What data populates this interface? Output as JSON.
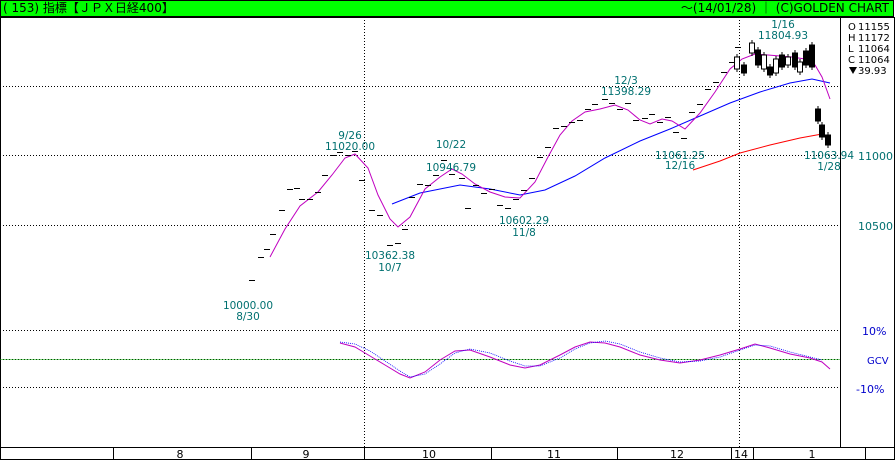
{
  "header": {
    "code": "( 153)",
    "name": "指標【ＪＰＸ日経400】",
    "date": "～(14/01/28)",
    "brand": "(C)GOLDEN CHART"
  },
  "ohlc": {
    "open_label": "O",
    "open": "11155",
    "high_label": "H",
    "high": "11172",
    "low_label": "L",
    "low": "11064",
    "close_label": "C",
    "close": "11064",
    "change": "39.93"
  },
  "colors": {
    "title_bg": "#00ff00",
    "label": "#007070",
    "ma_short": "#0000ff",
    "ma_long": "#ff0000",
    "stoch": "#c000c0"
  },
  "chart_data": {
    "type": "candlestick",
    "y_ticks": [
      10500,
      11000
    ],
    "y_tick_labels": [
      "10500",
      "11000"
    ],
    "osc_ticks": [
      "10%",
      "GCV",
      "-10%"
    ],
    "x_ticks": [
      "8",
      "9",
      "10",
      "11",
      "12",
      "14",
      "1"
    ],
    "annotations": [
      {
        "date": "8/30",
        "value": "10000.00"
      },
      {
        "date": "9/26",
        "value": "11020.00"
      },
      {
        "date": "10/7",
        "value": "10362.38"
      },
      {
        "date": "10/22",
        "value": "10946.79"
      },
      {
        "date": "11/8",
        "value": "10602.29"
      },
      {
        "date": "12/3",
        "value": "11398.29"
      },
      {
        "date": "12/16",
        "value": "11061.25"
      },
      {
        "date": "1/16",
        "value": "11804.93"
      },
      {
        "date": "1/28",
        "value": "11063.94"
      }
    ],
    "weekly_closes": [
      {
        "date": "8/30",
        "value": 10000
      },
      {
        "date": "9/06",
        "value": 10360
      },
      {
        "date": "9/13",
        "value": 10660
      },
      {
        "date": "9/20",
        "value": 10920
      },
      {
        "date": "9/26",
        "value": 11020
      },
      {
        "date": "10/04",
        "value": 10590
      },
      {
        "date": "10/07",
        "value": 10362
      },
      {
        "date": "10/11",
        "value": 10560
      },
      {
        "date": "10/22",
        "value": 10947
      },
      {
        "date": "10/31",
        "value": 10790
      },
      {
        "date": "11/08",
        "value": 10602
      },
      {
        "date": "11/15",
        "value": 10900
      },
      {
        "date": "11/22",
        "value": 11220
      },
      {
        "date": "12/03",
        "value": 11398
      },
      {
        "date": "12/16",
        "value": 11061
      },
      {
        "date": "12/27",
        "value": 11580
      },
      {
        "date": "1/10",
        "value": 11700
      },
      {
        "date": "1/16",
        "value": 11805
      },
      {
        "date": "1/21",
        "value": 11690
      },
      {
        "date": "1/28",
        "value": 11064
      }
    ]
  }
}
